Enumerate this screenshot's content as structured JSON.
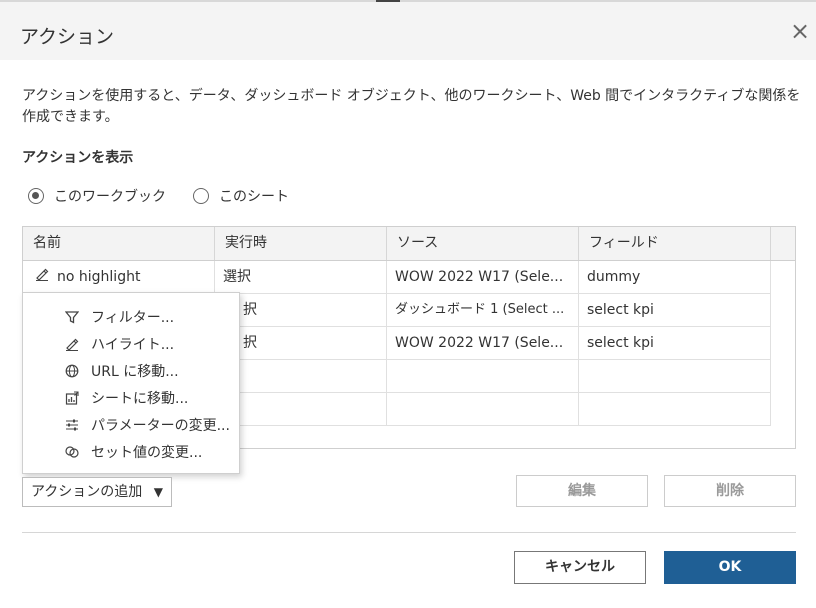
{
  "dialog": {
    "title": "アクション",
    "close_glyph": "×",
    "description": "アクションを使用すると、データ、ダッシュボード オブジェクト、他のワークシート、Web 間でインタラクティブな関係を作成できます。",
    "section_label": "アクションを表示"
  },
  "scope": {
    "workbook_label": "このワークブック",
    "sheet_label": "このシート",
    "selected": "workbook"
  },
  "table": {
    "headers": [
      "名前",
      "実行時",
      "ソース",
      "フィールド"
    ],
    "rows": [
      {
        "name": "no highlight",
        "run_on": "選択",
        "source": "WOW 2022 W17 (Sele...",
        "field": "dummy"
      },
      {
        "name": "",
        "run_on": "択",
        "source": "ダッシュボード 1 (Select ...",
        "field": "select kpi"
      },
      {
        "name": "",
        "run_on": "択",
        "source": "WOW 2022 W17 (Sele...",
        "field": "select kpi"
      }
    ]
  },
  "menu": {
    "items": [
      {
        "label": "フィルター...",
        "icon": "filter-icon"
      },
      {
        "label": "ハイライト...",
        "icon": "highlighter-icon"
      },
      {
        "label": "URL に移動...",
        "icon": "globe-icon"
      },
      {
        "label": "シートに移動...",
        "icon": "sheet-chart-icon"
      },
      {
        "label": "パラメーターの変更...",
        "icon": "sliders-icon"
      },
      {
        "label": "セット値の変更...",
        "icon": "set-venn-icon"
      }
    ]
  },
  "buttons": {
    "add_action": "アクションの追加",
    "add_caret": "▼",
    "edit": "編集",
    "delete": "削除",
    "cancel": "キャンセル",
    "ok": "OK"
  },
  "colors": {
    "accent": "#1f5f95",
    "title_bg": "#f4f4f4",
    "header_bg": "#f3f3f3"
  }
}
